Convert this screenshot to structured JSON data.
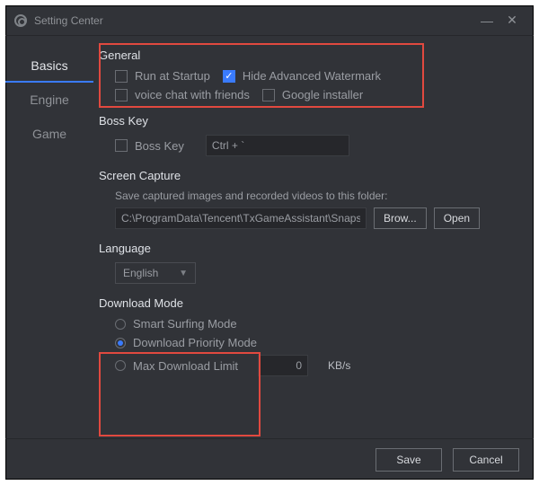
{
  "window": {
    "title": "Setting Center"
  },
  "sidebar": {
    "items": [
      {
        "label": "Basics",
        "active": true
      },
      {
        "label": "Engine",
        "active": false
      },
      {
        "label": "Game",
        "active": false
      }
    ]
  },
  "general": {
    "title": "General",
    "run_at_startup": {
      "label": "Run at Startup",
      "checked": false
    },
    "hide_watermark": {
      "label": "Hide Advanced Watermark",
      "checked": true
    },
    "voice_chat": {
      "label": "voice chat with friends",
      "checked": false
    },
    "google_installer": {
      "label": "Google installer",
      "checked": false
    }
  },
  "boss_key": {
    "title": "Boss Key",
    "enable": {
      "label": "Boss Key",
      "checked": false
    },
    "shortcut": "Ctrl + `"
  },
  "screen_capture": {
    "title": "Screen Capture",
    "hint": "Save captured images and recorded videos to this folder:",
    "path": "C:\\ProgramData\\Tencent\\TxGameAssistant\\Snapshot",
    "browse": "Brow...",
    "open": "Open"
  },
  "language": {
    "title": "Language",
    "selected": "English"
  },
  "download_mode": {
    "title": "Download Mode",
    "smart": {
      "label": "Smart Surfing Mode",
      "selected": false
    },
    "priority": {
      "label": "Download Priority Mode",
      "selected": true
    },
    "max_limit": {
      "label": "Max Download Limit",
      "selected": false
    },
    "limit_value": "0",
    "limit_unit": "KB/s"
  },
  "footer": {
    "save": "Save",
    "cancel": "Cancel"
  }
}
